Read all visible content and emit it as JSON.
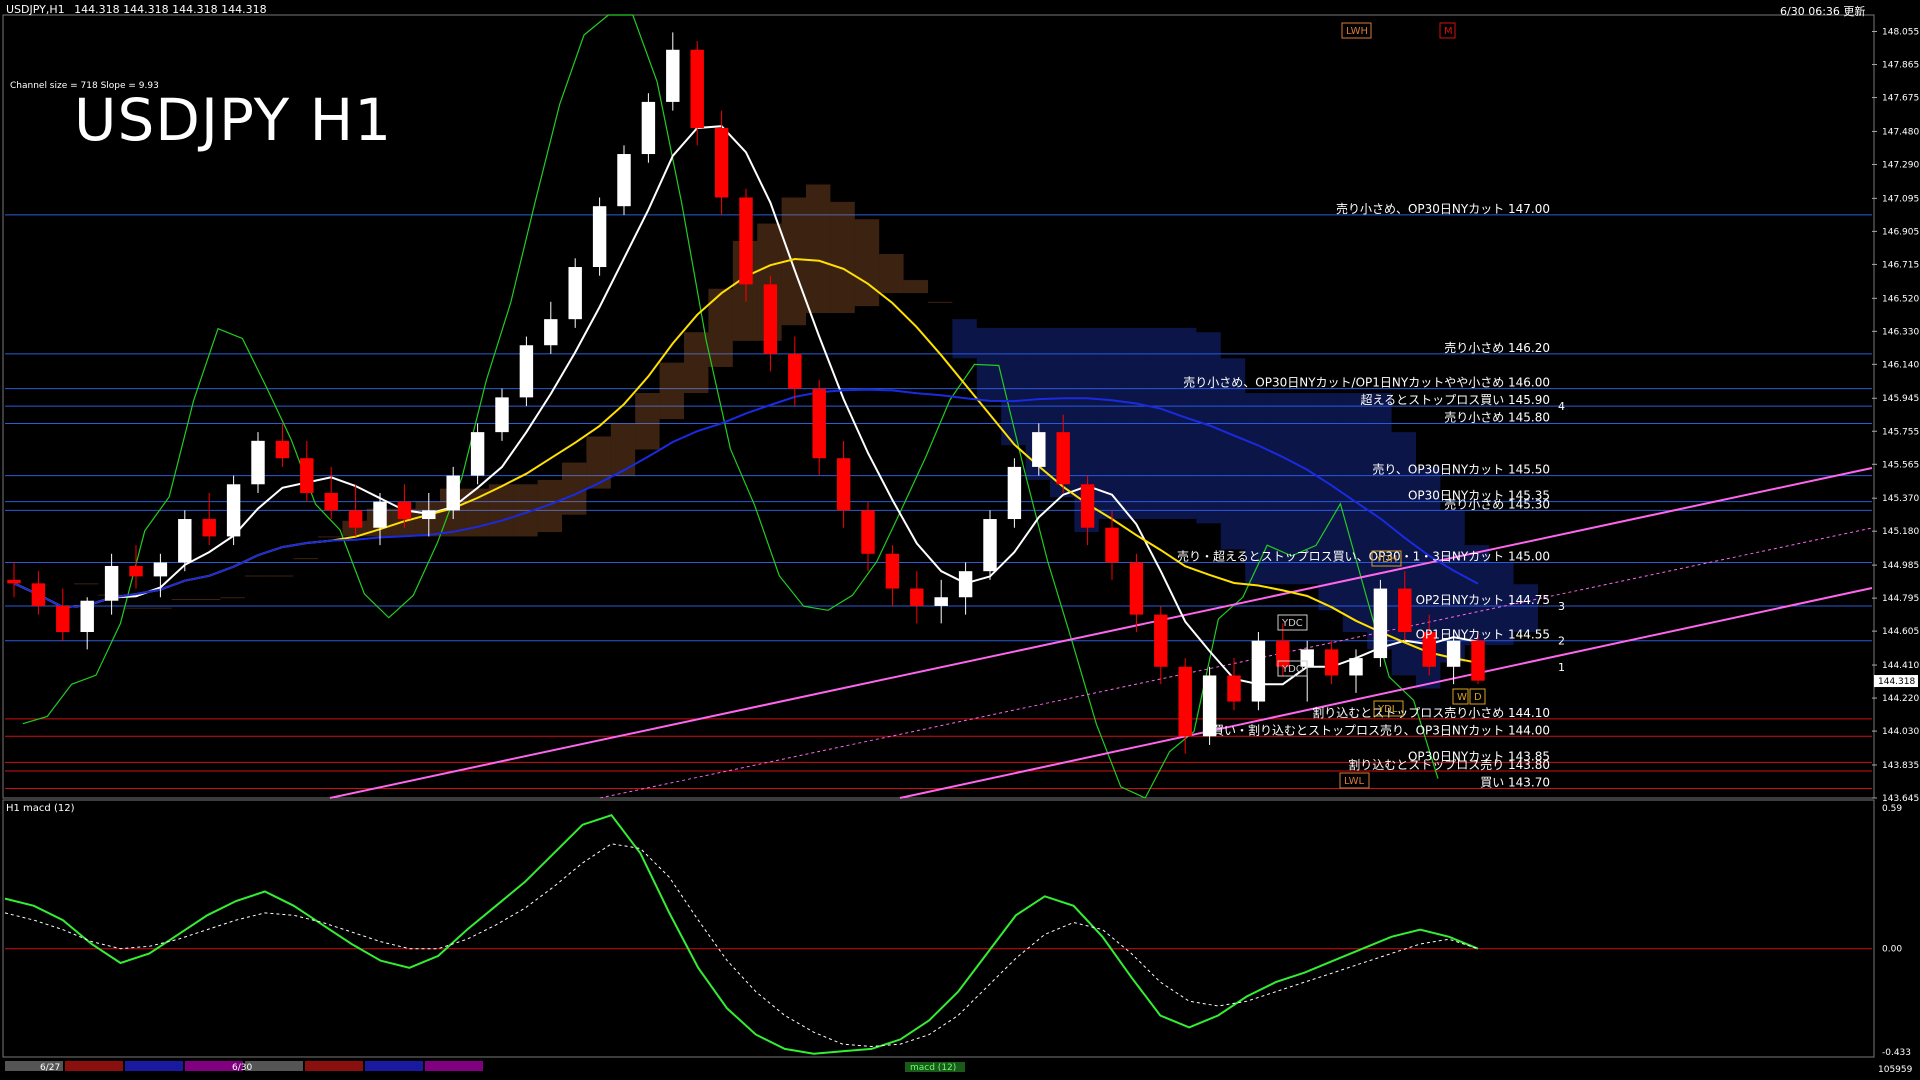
{
  "header": {
    "symbol_info": "USDJPY,H1",
    "ohlc": "144.318 144.318 144.318 144.318",
    "updated": "6/30 06:36 更新",
    "big_title": "USDJPY H1",
    "channel_info": "Channel size = 718  Slope = 9.93"
  },
  "colors": {
    "background": "#000000",
    "bull": "#ffffff",
    "bear": "#ff0000",
    "level_line": "#2a5cd6",
    "red_level": "#d01010",
    "sma_white": "#ffffff",
    "sma_yellow": "#ffe000",
    "sma_blue": "#1a2ae0",
    "channel": "#ff66ee",
    "macd_green": "#33ee33",
    "macd_pink": "#ff6699",
    "ichimoku_green": "#22cc22",
    "cloud_blue": "#2a4aff",
    "cloud_orange": "#d77a3a"
  },
  "chart_data": {
    "type": "candlestick",
    "ylim": [
      143.645,
      148.15
    ],
    "price_ticks": [
      "148.055",
      "147.865",
      "147.675",
      "147.480",
      "147.290",
      "147.095",
      "146.905",
      "146.715",
      "146.520",
      "146.330",
      "146.140",
      "145.945",
      "145.755",
      "145.565",
      "145.370",
      "145.180",
      "144.985",
      "144.795",
      "144.605",
      "144.410",
      "144.220",
      "144.030",
      "143.835",
      "143.645"
    ],
    "current_price": "144.318",
    "candles": [
      [
        144.9,
        145.0,
        144.8,
        144.88
      ],
      [
        144.88,
        144.95,
        144.7,
        144.75
      ],
      [
        144.75,
        144.85,
        144.55,
        144.6
      ],
      [
        144.6,
        144.8,
        144.5,
        144.78
      ],
      [
        144.78,
        145.05,
        144.7,
        144.98
      ],
      [
        144.98,
        145.1,
        144.85,
        144.92
      ],
      [
        144.92,
        145.05,
        144.8,
        145.0
      ],
      [
        145.0,
        145.3,
        144.95,
        145.25
      ],
      [
        145.25,
        145.4,
        145.1,
        145.15
      ],
      [
        145.15,
        145.5,
        145.1,
        145.45
      ],
      [
        145.45,
        145.75,
        145.4,
        145.7
      ],
      [
        145.7,
        145.8,
        145.55,
        145.6
      ],
      [
        145.6,
        145.7,
        145.35,
        145.4
      ],
      [
        145.4,
        145.55,
        145.25,
        145.3
      ],
      [
        145.3,
        145.45,
        145.15,
        145.2
      ],
      [
        145.2,
        145.4,
        145.1,
        145.35
      ],
      [
        145.35,
        145.45,
        145.2,
        145.25
      ],
      [
        145.25,
        145.4,
        145.15,
        145.3
      ],
      [
        145.3,
        145.55,
        145.25,
        145.5
      ],
      [
        145.5,
        145.8,
        145.45,
        145.75
      ],
      [
        145.75,
        146.0,
        145.7,
        145.95
      ],
      [
        145.95,
        146.3,
        145.9,
        146.25
      ],
      [
        146.25,
        146.5,
        146.2,
        146.4
      ],
      [
        146.4,
        146.75,
        146.35,
        146.7
      ],
      [
        146.7,
        147.1,
        146.65,
        147.05
      ],
      [
        147.05,
        147.4,
        147.0,
        147.35
      ],
      [
        147.35,
        147.7,
        147.3,
        147.65
      ],
      [
        147.65,
        148.05,
        147.6,
        147.95
      ],
      [
        147.95,
        148.0,
        147.4,
        147.5
      ],
      [
        147.5,
        147.6,
        147.0,
        147.1
      ],
      [
        147.1,
        147.15,
        146.5,
        146.6
      ],
      [
        146.6,
        146.65,
        146.1,
        146.2
      ],
      [
        146.2,
        146.3,
        145.9,
        146.0
      ],
      [
        146.0,
        146.05,
        145.5,
        145.6
      ],
      [
        145.6,
        145.7,
        145.2,
        145.3
      ],
      [
        145.3,
        145.35,
        144.95,
        145.05
      ],
      [
        145.05,
        145.1,
        144.75,
        144.85
      ],
      [
        144.85,
        144.95,
        144.65,
        144.75
      ],
      [
        144.75,
        144.9,
        144.65,
        144.8
      ],
      [
        144.8,
        145.0,
        144.7,
        144.95
      ],
      [
        144.95,
        145.3,
        144.9,
        145.25
      ],
      [
        145.25,
        145.6,
        145.2,
        145.55
      ],
      [
        145.55,
        145.8,
        145.5,
        145.75
      ],
      [
        145.75,
        145.85,
        145.4,
        145.45
      ],
      [
        145.45,
        145.5,
        145.1,
        145.2
      ],
      [
        145.2,
        145.3,
        144.9,
        145.0
      ],
      [
        145.0,
        145.05,
        144.6,
        144.7
      ],
      [
        144.7,
        144.75,
        144.3,
        144.4
      ],
      [
        144.4,
        144.45,
        143.9,
        144.0
      ],
      [
        144.0,
        144.4,
        143.95,
        144.35
      ],
      [
        144.35,
        144.45,
        144.15,
        144.2
      ],
      [
        144.2,
        144.6,
        144.15,
        144.55
      ],
      [
        144.55,
        144.65,
        144.35,
        144.4
      ],
      [
        144.4,
        144.55,
        144.2,
        144.5
      ],
      [
        144.5,
        144.55,
        144.3,
        144.35
      ],
      [
        144.35,
        144.5,
        144.25,
        144.45
      ],
      [
        144.45,
        144.9,
        144.4,
        144.85
      ],
      [
        144.85,
        144.95,
        144.55,
        144.6
      ],
      [
        144.6,
        144.7,
        144.35,
        144.4
      ],
      [
        144.4,
        144.6,
        144.3,
        144.55
      ],
      [
        144.55,
        144.6,
        144.3,
        144.32
      ]
    ],
    "levels": [
      {
        "price": 147.0,
        "label": "売り小さめ、OP30日NYカット 147.00"
      },
      {
        "price": 146.2,
        "label": "売り小さめ 146.20"
      },
      {
        "price": 146.0,
        "label": "売り小さめ、OP30日NYカット/OP1日NYカットやや小さめ 146.00"
      },
      {
        "price": 145.9,
        "label": "超えるとストップロス買い 145.90"
      },
      {
        "price": 145.8,
        "label": "売り小さめ 145.80"
      },
      {
        "price": 145.5,
        "label": "売り、OP30日NYカット 145.50"
      },
      {
        "price": 145.35,
        "label": "OP30日NYカット 145.35"
      },
      {
        "price": 145.3,
        "label": "売り小さめ 145.30"
      },
      {
        "price": 145.0,
        "label": "売り・超えるとストップロス買い、OP30・1・3日NYカット 145.00"
      },
      {
        "price": 144.75,
        "label": "OP2日NYカット 144.75"
      },
      {
        "price": 144.55,
        "label": "OP1日NYカット 144.55"
      },
      {
        "price": 144.1,
        "label": "割り込むとストップロス売り小さめ 144.10"
      },
      {
        "price": 144.0,
        "label": "買い・割り込むとストップロス売り、OP3日NYカット 144.00"
      },
      {
        "price": 143.85,
        "label": "OP30日NYカット 143.85"
      },
      {
        "price": 143.8,
        "label": "割り込むとストップロス売り 143.80"
      },
      {
        "price": 143.7,
        "label": "買い 143.70"
      }
    ],
    "level_markers": [
      "4",
      "3",
      "2",
      "1"
    ],
    "tags": [
      "LWH",
      "M",
      "YDH",
      "YDC",
      "YDO",
      "YDL",
      "LWL",
      "W",
      "D"
    ],
    "macd": {
      "name": "H1 macd (12)",
      "ticks": [
        "0.59",
        "0.00",
        "-0.433"
      ],
      "ylim": [
        -0.433,
        0.59
      ],
      "main": [
        0.21,
        0.18,
        0.12,
        0.02,
        -0.06,
        -0.02,
        0.06,
        0.14,
        0.2,
        0.24,
        0.18,
        0.1,
        0.02,
        -0.05,
        -0.08,
        -0.03,
        0.08,
        0.18,
        0.28,
        0.4,
        0.52,
        0.56,
        0.4,
        0.15,
        -0.08,
        -0.25,
        -0.36,
        -0.42,
        -0.44,
        -0.43,
        -0.42,
        -0.38,
        -0.3,
        -0.18,
        -0.02,
        0.14,
        0.22,
        0.18,
        0.05,
        -0.12,
        -0.28,
        -0.33,
        -0.28,
        -0.2,
        -0.14,
        -0.1,
        -0.05,
        0.0,
        0.05,
        0.08,
        0.05,
        0.0
      ],
      "signal": [
        0.15,
        0.12,
        0.08,
        0.03,
        0.0,
        0.01,
        0.04,
        0.08,
        0.12,
        0.15,
        0.14,
        0.11,
        0.07,
        0.03,
        0.0,
        0.0,
        0.04,
        0.1,
        0.17,
        0.26,
        0.36,
        0.44,
        0.42,
        0.3,
        0.12,
        -0.05,
        -0.18,
        -0.28,
        -0.35,
        -0.4,
        -0.41,
        -0.4,
        -0.36,
        -0.28,
        -0.16,
        -0.04,
        0.06,
        0.11,
        0.08,
        -0.02,
        -0.14,
        -0.22,
        -0.24,
        -0.22,
        -0.18,
        -0.14,
        -0.1,
        -0.06,
        -0.02,
        0.02,
        0.04,
        0.0
      ]
    },
    "time_labels": [
      "6/27",
      "6/30"
    ],
    "bottom_label": "105959",
    "bottom_center": "macd (12)"
  }
}
